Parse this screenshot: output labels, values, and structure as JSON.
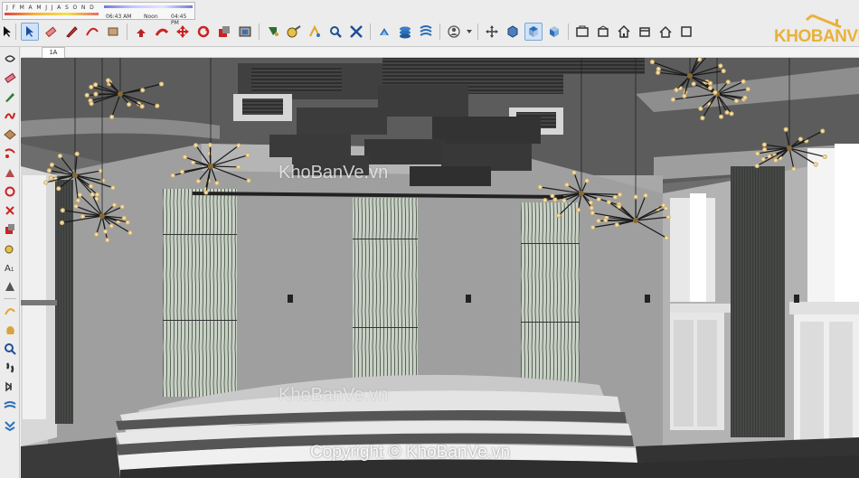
{
  "shadow_settings": {
    "months": "J F M A M J J A S O N D",
    "time_start": "06:43 AM",
    "time_noon": "Noon",
    "time_end": "04:45 PM"
  },
  "scene_tab": {
    "label": "1A"
  },
  "watermarks": {
    "top": "KhoBanVe.vn",
    "bottom": "KhoBanVe.vn",
    "copyright": "Copyright © KhoBanVe.vn"
  },
  "logo": {
    "text": "KHOBANVE"
  },
  "colors": {
    "accent": "#e8b23a",
    "toolbar_bg": "#ececec",
    "active_tool": "#cfe2f7"
  },
  "toolbar_icons": [
    "select-icon",
    "eraser-icon",
    "pencil-icon",
    "arc-icon",
    "rectangle-icon",
    "push-pull-icon",
    "follow-me-icon",
    "move-icon",
    "rotate-icon",
    "scale-icon",
    "offset-icon",
    "paint-icon",
    "tape-measure-icon",
    "text-icon",
    "orbit-icon",
    "pan-icon",
    "zoom-icon",
    "zoom-extents-icon",
    "sandbox-icon",
    "layers-icon",
    "styles-icon",
    "user-icon",
    "axes-icon",
    "iso-view-icon",
    "top-view-icon",
    "front-view-icon",
    "right-view-icon",
    "back-view-icon",
    "left-view-icon",
    "house-icon",
    "section-icon"
  ]
}
